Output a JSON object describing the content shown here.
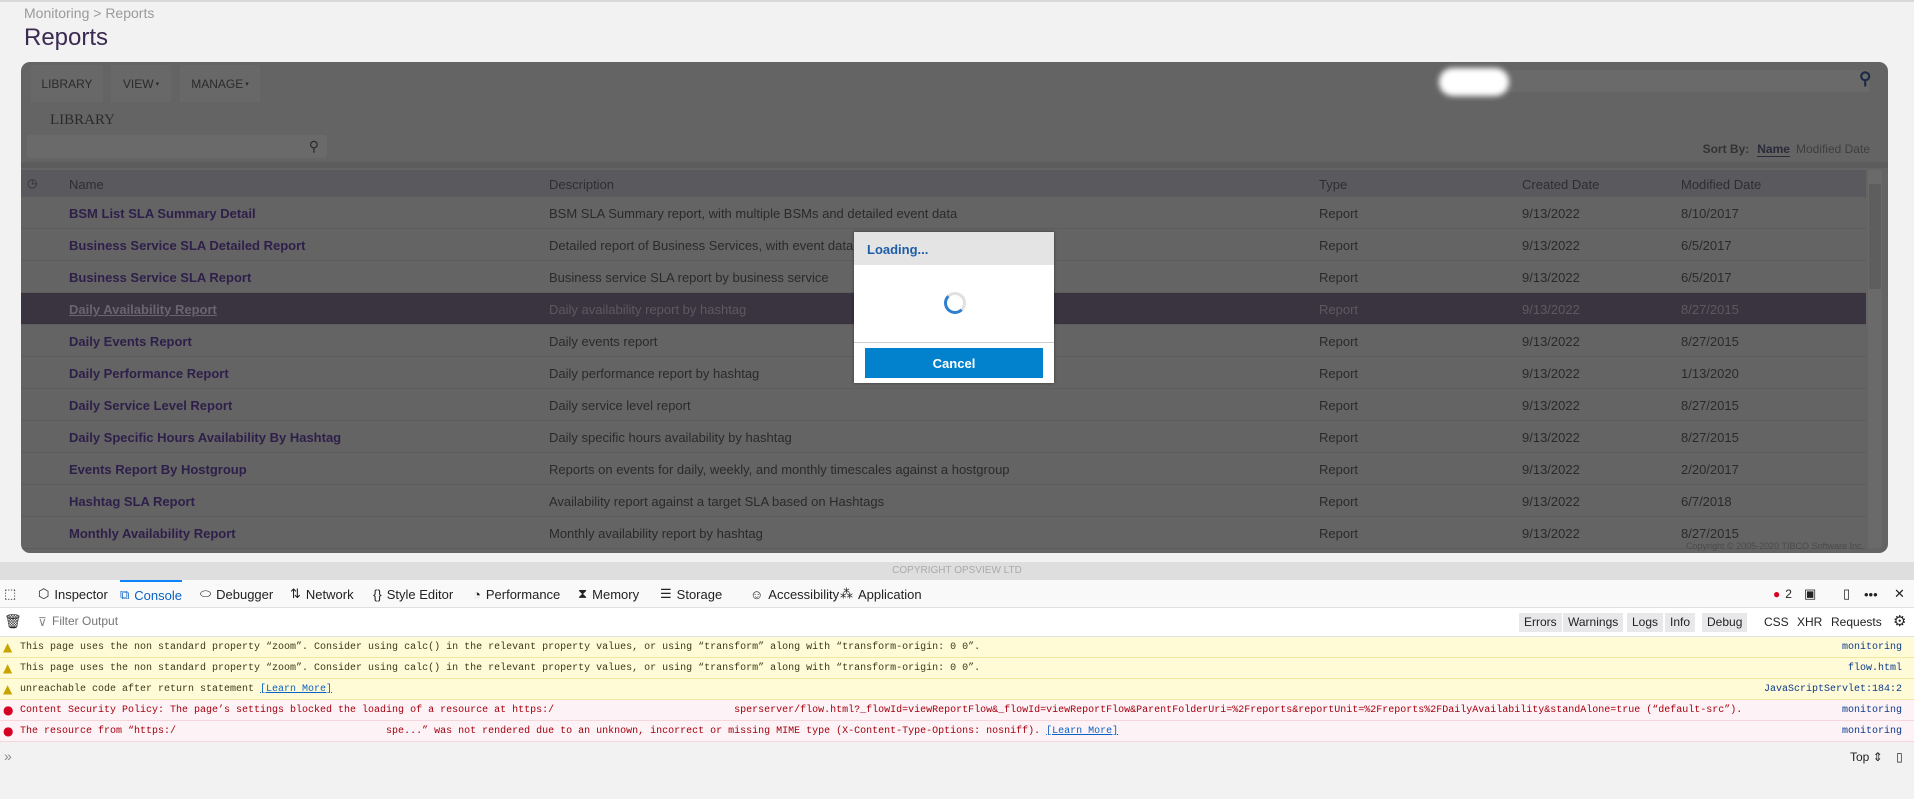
{
  "breadcrumb": "Monitoring > Reports",
  "page_title": "Reports",
  "toolbar": {
    "library": "LIBRARY",
    "view": "VIEW",
    "manage": "MANAGE"
  },
  "section_label": "LIBRARY",
  "sort": {
    "label": "Sort By:",
    "name": "Name",
    "modified": "Modified Date"
  },
  "columns": [
    "Name",
    "Description",
    "Type",
    "Created Date",
    "Modified Date"
  ],
  "rows": [
    [
      "BSM List SLA Summary Detail",
      "BSM SLA Summary report, with multiple BSMs and detailed event data",
      "Report",
      "9/13/2022",
      "8/10/2017"
    ],
    [
      "Business Service SLA Detailed Report",
      "Detailed report of Business Services, with event data",
      "Report",
      "9/13/2022",
      "6/5/2017"
    ],
    [
      "Business Service SLA Report",
      "Business service SLA report by business service",
      "Report",
      "9/13/2022",
      "6/5/2017"
    ],
    [
      "Daily Availability Report",
      "Daily availability report by hashtag",
      "Report",
      "9/13/2022",
      "8/27/2015"
    ],
    [
      "Daily Events Report",
      "Daily events report",
      "Report",
      "9/13/2022",
      "8/27/2015"
    ],
    [
      "Daily Performance Report",
      "Daily performance report by hashtag",
      "Report",
      "9/13/2022",
      "1/13/2020"
    ],
    [
      "Daily Service Level Report",
      "Daily service level report",
      "Report",
      "9/13/2022",
      "8/27/2015"
    ],
    [
      "Daily Specific Hours Availability By Hashtag",
      "Daily specific hours availability by hashtag",
      "Report",
      "9/13/2022",
      "8/27/2015"
    ],
    [
      "Events Report By Hostgroup",
      "Reports on events for daily, weekly, and monthly timescales against a hostgroup",
      "Report",
      "9/13/2022",
      "2/20/2017"
    ],
    [
      "Hashtag SLA Report",
      "Availability report against a target SLA based on Hashtags",
      "Report",
      "9/13/2022",
      "6/7/2018"
    ],
    [
      "Monthly Availability Report",
      "Monthly availability report by hashtag",
      "Report",
      "9/13/2022",
      "8/27/2015"
    ]
  ],
  "selected_row": 3,
  "tibco_copyright": "Copyright © 2005-2020 TIBCO Software Inc.",
  "dialog": {
    "title": "Loading...",
    "cancel": "Cancel"
  },
  "footer": "COPYRIGHT OPSVIEW LTD",
  "devtools": {
    "tabs": [
      "Inspector",
      "Console",
      "Debugger",
      "Network",
      "Style Editor",
      "Performance",
      "Memory",
      "Storage",
      "Accessibility",
      "Application"
    ],
    "active_tab": "Console",
    "error_count": "2",
    "filter_placeholder": "Filter Output",
    "filters": [
      "Errors",
      "Warnings",
      "Logs",
      "Info",
      "Debug"
    ],
    "filters2": [
      "CSS",
      "XHR",
      "Requests"
    ],
    "messages": [
      {
        "level": "warning",
        "text": "This page uses the non standard property “zoom”. Consider using calc() in the relevant property values, or using “transform” along with “transform-origin: 0 0”.",
        "source": "monitoring"
      },
      {
        "level": "warning",
        "text": "This page uses the non standard property “zoom”. Consider using calc() in the relevant property values, or using “transform” along with “transform-origin: 0 0”.",
        "source": "flow.html"
      },
      {
        "level": "warning",
        "text": "unreachable code after return statement ",
        "link": "[Learn More]",
        "source": "JavaScriptServlet:184:2"
      },
      {
        "level": "error",
        "text": "Content Security Policy: The page’s settings blocked the loading of a resource at https:/                              sperserver/flow.html?_flowId=viewReportFlow&_flowId=viewReportFlow&ParentFolderUri=%2Freports&reportUnit=%2Freports%2FDailyAvailability&standAlone=true (“default-src”).",
        "source": "monitoring"
      },
      {
        "level": "error",
        "text": "The resource from “https:/                                   spe...” was not rendered due to an unknown, incorrect or missing MIME type (X-Content-Type-Options: nosniff). ",
        "link": "[Learn More]",
        "source": "monitoring"
      }
    ],
    "context": "Top"
  },
  "colors": {
    "accent": "#0282cc",
    "selected_row": "#3a3340",
    "name_text": "#2e1f4a",
    "overlay": "#646464"
  }
}
